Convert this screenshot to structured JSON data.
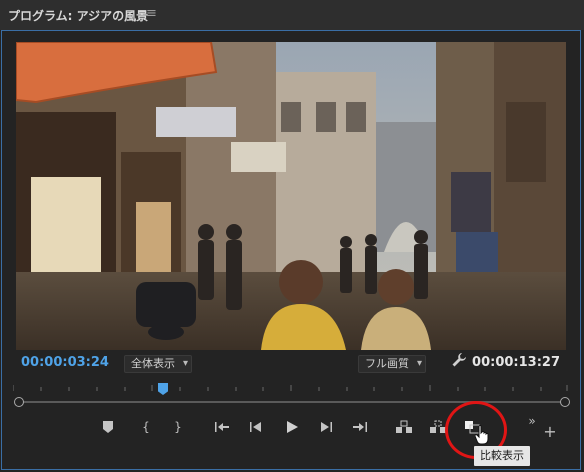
{
  "panel": {
    "title": "プログラム: アジアの風景",
    "menu_icon": "hamburger-icon"
  },
  "timecode": {
    "current": "00:00:03:24",
    "duration": "00:00:13:27"
  },
  "zoom_select": {
    "value": "全体表示"
  },
  "quality_select": {
    "value": "フル画質"
  },
  "controls": {
    "buttons": [
      "add-marker-icon",
      "mark-in-icon",
      "mark-out-icon",
      "go-to-in-icon",
      "step-back-icon",
      "play-icon",
      "step-forward-icon",
      "go-to-out-icon",
      "lift-icon",
      "extract-icon",
      "comparison-view-icon"
    ],
    "overflow_icon": "chevron-double-right-icon",
    "add_icon": "plus-icon"
  },
  "playhead_fraction": 0.27,
  "tooltip": {
    "text": "比較表示"
  },
  "colors": {
    "accent": "#4fa3e8",
    "highlight_circle": "#e01515",
    "background": "#232323"
  }
}
